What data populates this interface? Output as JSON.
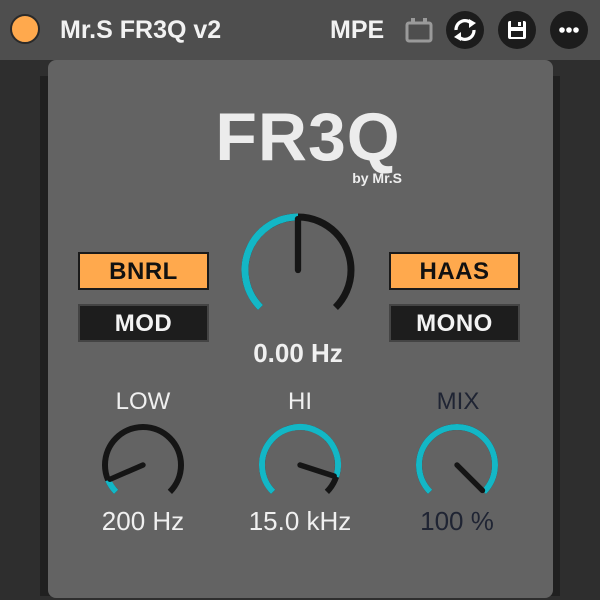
{
  "header": {
    "title": "Mr.S FR3Q v2",
    "mpe_label": "MPE",
    "icons": {
      "power": "power-toggle-icon",
      "mpe": "midi-connector-icon",
      "refresh": "refresh-icon",
      "save": "save-icon",
      "more": "more-options-icon"
    }
  },
  "logo": {
    "title": "FR3Q",
    "byline": "by Mr.S"
  },
  "buttons": {
    "bnrl": {
      "label": "BNRL",
      "state": "on"
    },
    "mod": {
      "label": "MOD",
      "state": "off"
    },
    "haas": {
      "label": "HAAS",
      "state": "on"
    },
    "mono": {
      "label": "MONO",
      "state": "off"
    }
  },
  "knobs": {
    "freq": {
      "label": "",
      "value": "0.00 Hz",
      "position": 0.5
    },
    "low": {
      "label": "LOW",
      "value": "200 Hz",
      "position": 0.08
    },
    "hi": {
      "label": "HI",
      "value": "15.0 kHz",
      "position": 0.9
    },
    "mix": {
      "label": "MIX",
      "value": "100 %",
      "position": 1.0
    }
  },
  "colors": {
    "accent_orange": "#ffa94d",
    "knob_arc": "#13b7c6",
    "knob_track": "#151515",
    "panel": "#636363",
    "titlebar": "#4e4e4e",
    "text_light": "#f0f0f0",
    "mix_text": "#1f2433"
  }
}
